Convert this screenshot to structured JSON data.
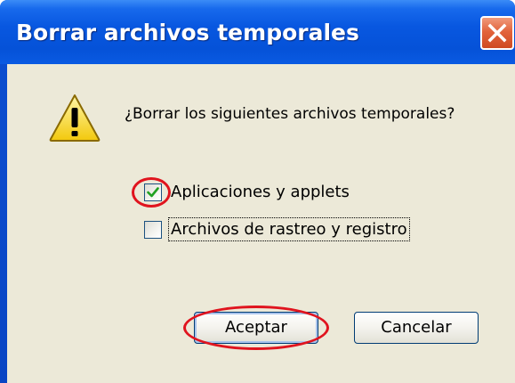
{
  "dialog": {
    "title": "Borrar archivos temporales",
    "message": "¿Borrar los siguientes archivos temporales?",
    "options": [
      {
        "label": "Aplicaciones y applets",
        "checked": true
      },
      {
        "label": "Archivos de rastreo y registro",
        "checked": false
      }
    ],
    "buttons": {
      "ok_label": "Aceptar",
      "cancel_label": "Cancelar"
    },
    "icons": {
      "warning": "warning-icon",
      "close": "close-icon",
      "check": "checkmark-icon"
    },
    "colors": {
      "titlebar": "#0a5ae2",
      "close_button": "#e2643c",
      "client_background": "#ece9d8",
      "checkmark": "#21a121",
      "highlight_annotation": "#e0141e"
    }
  }
}
